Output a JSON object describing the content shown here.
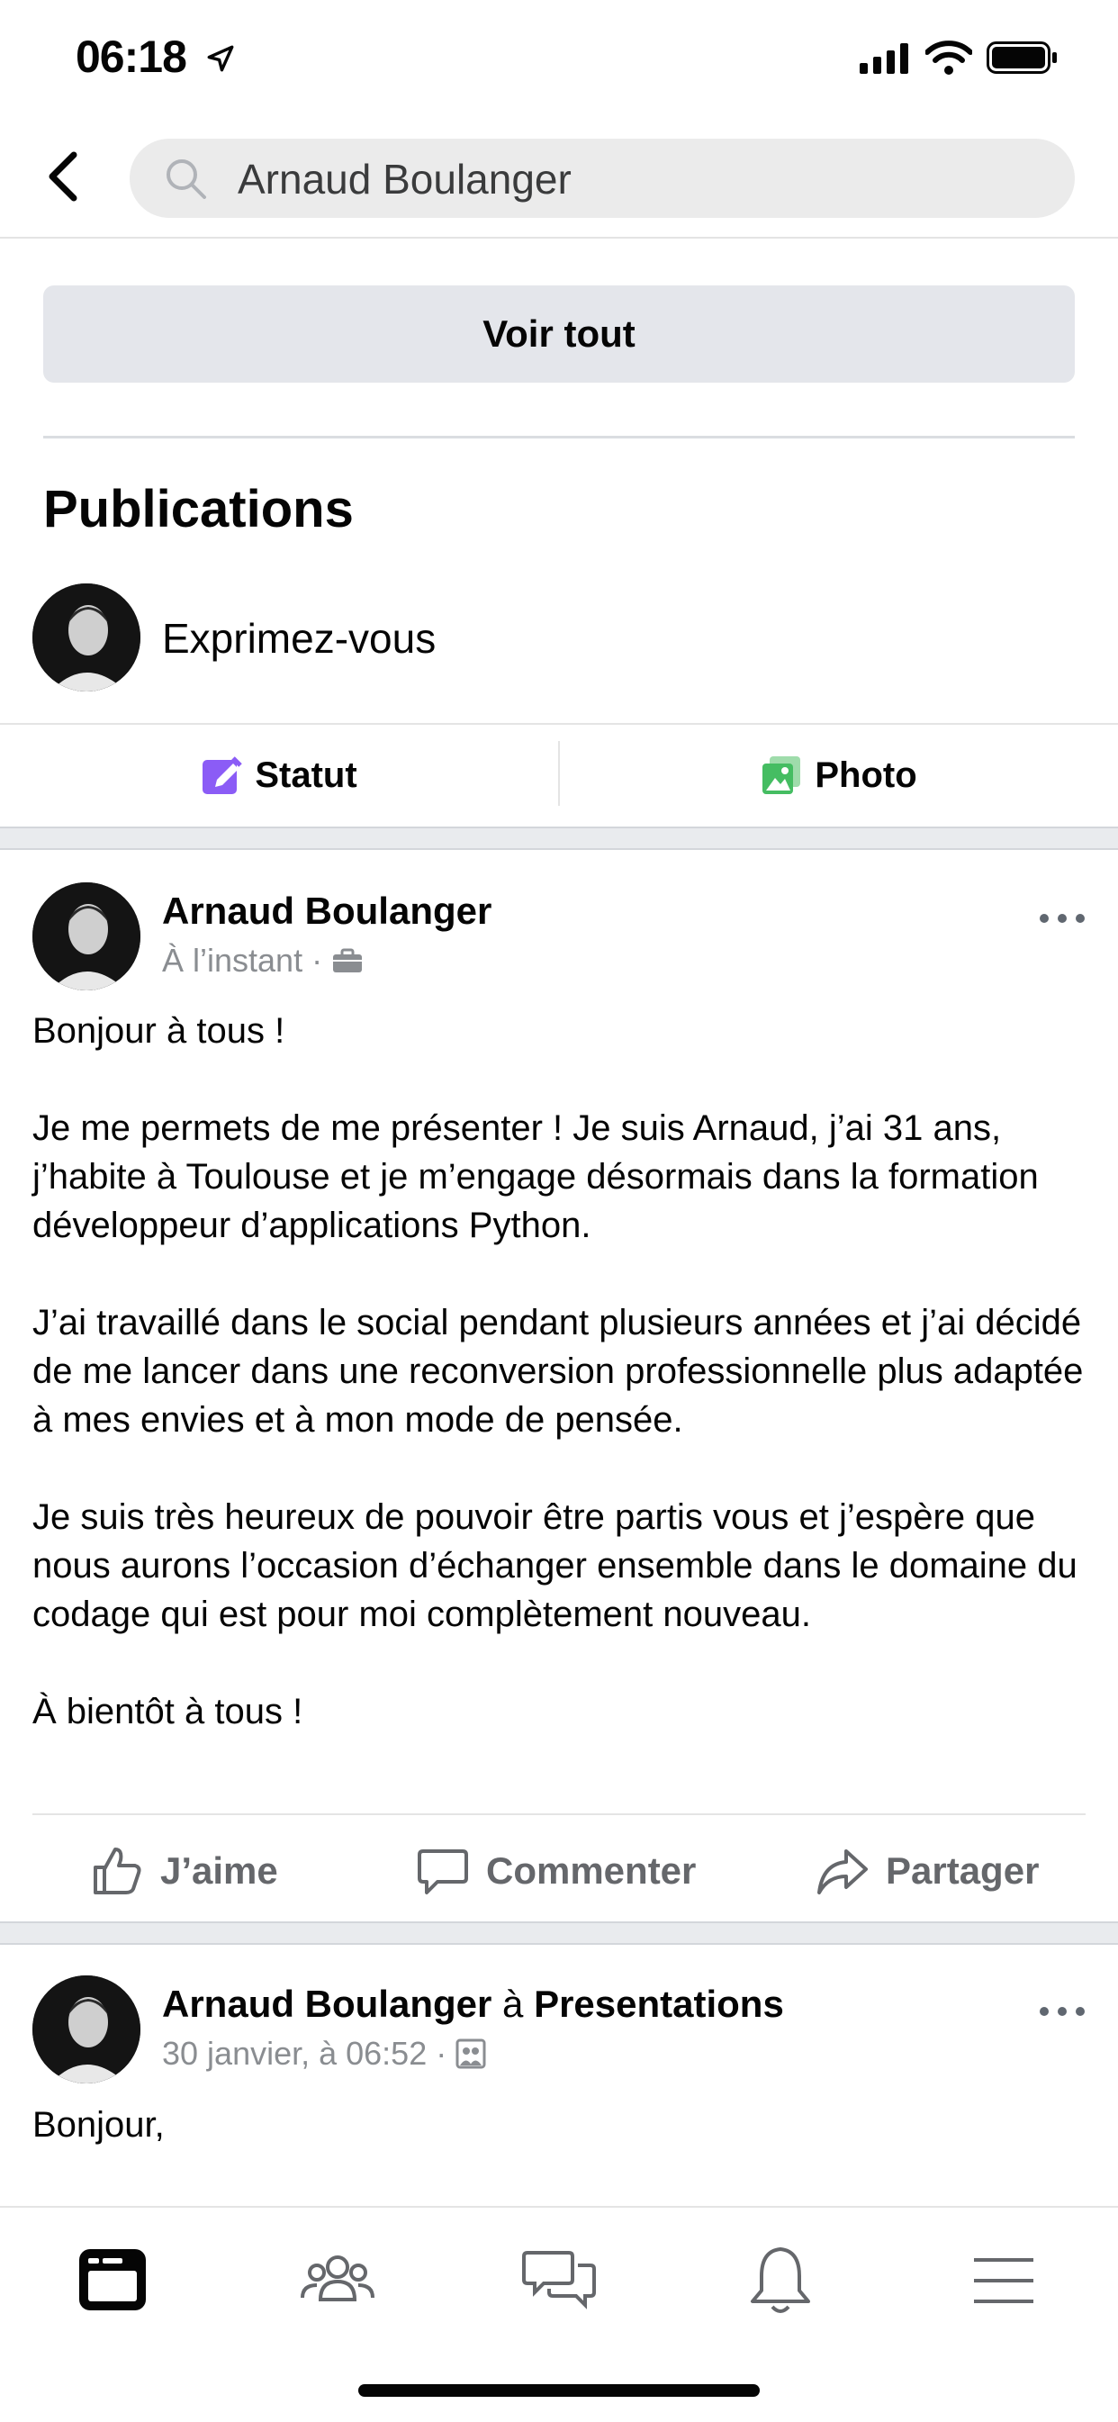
{
  "status_bar": {
    "time": "06:18"
  },
  "search": {
    "query": "Arnaud Boulanger"
  },
  "voir_tout": "Voir tout",
  "section_title": "Publications",
  "composer": {
    "prompt": "Exprimez-vous",
    "status_label": "Statut",
    "photo_label": "Photo"
  },
  "post1": {
    "author": "Arnaud Boulanger",
    "time": "À l’instant",
    "body": [
      "Bonjour à tous !",
      "Je me permets de me présenter ! Je suis Arnaud, j’ai 31 ans, j’habite à Toulouse et je m’engage désormais dans la formation développeur d’applications Python.",
      "J’ai travaillé dans le social pendant plusieurs années et j’ai décidé de me lancer dans une reconversion professionnelle plus adaptée à mes envies et à mon mode de pensée.",
      "Je suis très heureux de pouvoir être partis vous et j’espère que nous aurons l’occasion d’échanger ensemble dans le domaine du codage qui est pour moi complètement nouveau.",
      "À bientôt à tous !"
    ]
  },
  "reactions": {
    "like": "J’aime",
    "comment": "Commenter",
    "share": "Partager"
  },
  "post2": {
    "author": "Arnaud Boulanger",
    "connector": "à",
    "group": "Presentations",
    "time": "30 janvier, à 06:52",
    "body": "Bonjour,"
  },
  "colors": {
    "accent": "#1877f2",
    "status_icon": "#8b5cf6",
    "photo_icon": "#45bd62",
    "muted": "#65676b"
  }
}
